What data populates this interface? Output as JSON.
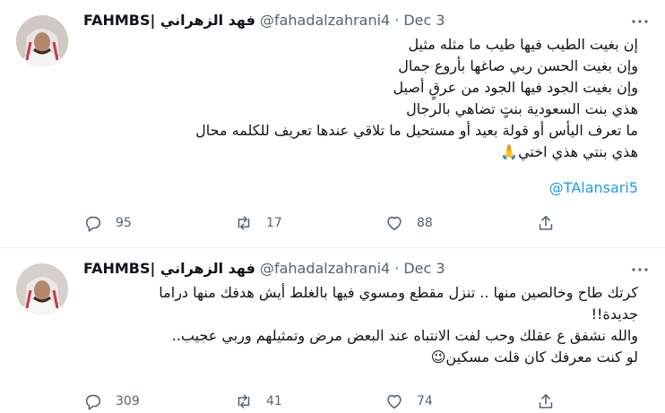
{
  "tweets": [
    {
      "display_name": "FAHMBS| فهد الزهراني",
      "handle": "@fahadalzahrani4",
      "separator": "·",
      "date": "Dec 3",
      "lines": [
        "إن بغيت الطيب فيها طيب ما مثله مثيل",
        "وإن بغيت الحسن ربي صاغها بأروع جمال",
        "وإن بغيت الجود فيها الجود من عرقٍ أصيل",
        "هذي بنت السعودية بنتٍ تضاهي بالرجال",
        "ما تعرف اليأس أو قولة بعيد أو مستحيل ما تلاقي عندها تعريف للكلمه محال",
        "هذي بنتي هذي اختي🙏"
      ],
      "mention": "@TAlansari5",
      "replies": "95",
      "retweets": "17",
      "likes": "88"
    },
    {
      "display_name": "FAHMBS| فهد الزهراني",
      "handle": "@fahadalzahrani4",
      "separator": "·",
      "date": "Dec 3",
      "lines": [
        "كرتك طاح وخالصين منها .. تنزل مقطع ومسوي فيها بالغلط أيش هدفك منها دراما",
        "جديدة!!",
        "والله نشفق ع عقلك وحب لفت الانتباه عند البعض مرض وتمثيلهم وربي عجيب..",
        "لو كنت معرفك كان قلت مسكين😉"
      ],
      "replies": "309",
      "retweets": "41",
      "likes": "74"
    }
  ],
  "icons": {
    "more": "more-dots-icon",
    "reply": "reply-icon",
    "retweet": "retweet-icon",
    "like": "heart-icon",
    "share": "share-icon"
  },
  "colors": {
    "text": "#0f1419",
    "secondary": "#536471",
    "link": "#1d9bf0",
    "divider": "#eff3f4"
  }
}
